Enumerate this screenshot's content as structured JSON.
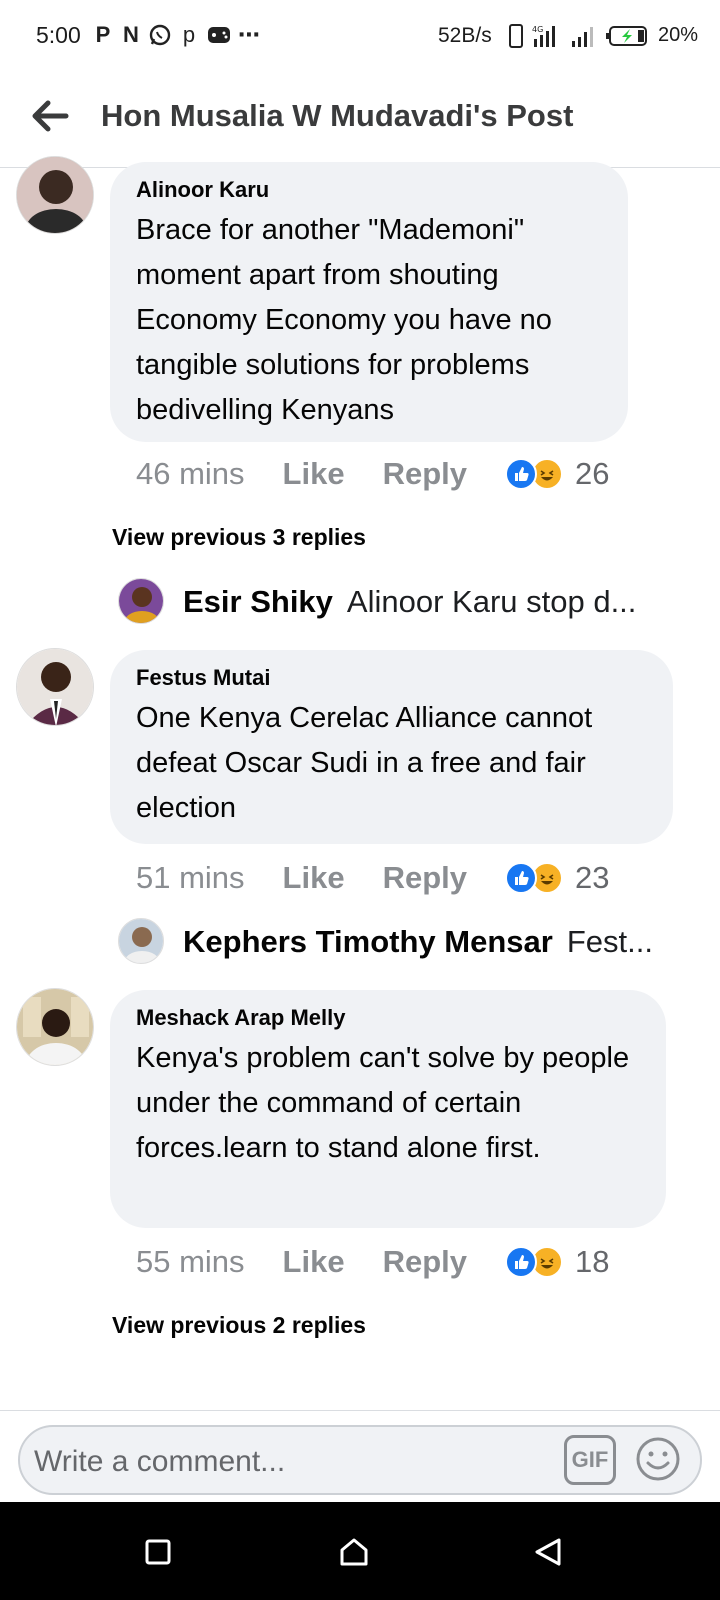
{
  "status_bar": {
    "time": "5:00",
    "speed": "52B/s",
    "battery": "20%",
    "left_icons": [
      "P",
      "N",
      "whatsapp-icon",
      "p",
      "game-icon",
      "⋯"
    ]
  },
  "header": {
    "title": "Hon Musalia W Mudavadi's Post"
  },
  "comments": [
    {
      "author": "Alinoor Karu",
      "text": "Brace for another \"Mademoni\" moment apart from shouting Economy Economy you have no tangible solutions for problems bedivelling Kenyans",
      "time": "46 mins",
      "like": "Like",
      "reply": "Reply",
      "reactions": "26",
      "view_previous": "View previous 3 replies",
      "reply_preview": {
        "name": "Esir Shiky",
        "text": "Alinoor Karu stop d..."
      }
    },
    {
      "author": "Festus Mutai",
      "text": "One Kenya Cerelac Alliance cannot defeat Oscar Sudi in a free and fair election",
      "time": "51 mins",
      "like": "Like",
      "reply": "Reply",
      "reactions": "23",
      "reply_preview": {
        "name": "Kephers Timothy Mensar",
        "text": "Fest..."
      }
    },
    {
      "author": "Meshack Arap Melly",
      "text": "Kenya's problem can't solve by people under the command of certain forces.learn to stand alone first.",
      "time": "55 mins",
      "like": "Like",
      "reply": "Reply",
      "reactions": "18",
      "view_previous": "View previous 2 replies"
    }
  ],
  "composer": {
    "placeholder": "Write a comment...",
    "gif_label": "GIF"
  },
  "colors": {
    "bubble": "#f0f2f5",
    "like_blue": "#1877f2",
    "haha_yellow": "#f7b125",
    "meta_gray": "#8a8d91"
  }
}
